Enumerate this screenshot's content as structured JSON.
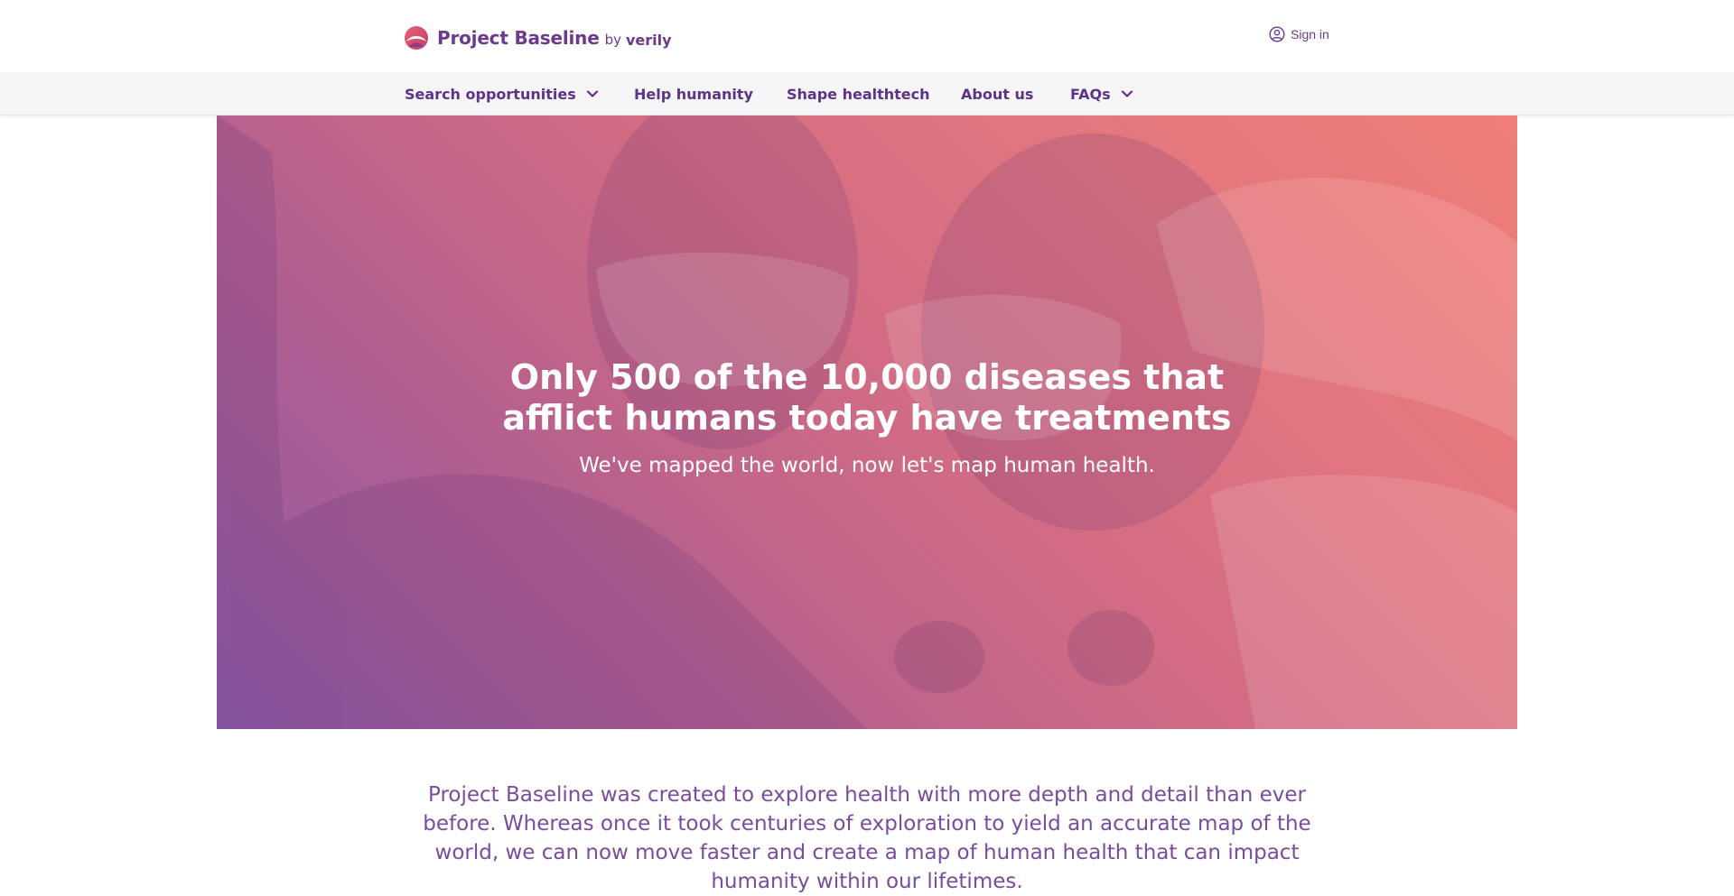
{
  "brand": {
    "name": "Project Baseline",
    "by": "by",
    "partner": "verily",
    "icon": "baseline-logo-icon",
    "primary_color": "#6b3a8d"
  },
  "header": {
    "signin_label": "Sign in",
    "signin_icon": "user-circle-icon"
  },
  "nav": {
    "items": [
      {
        "label": "Search opportunities",
        "has_dropdown": true
      },
      {
        "label": "Help humanity",
        "has_dropdown": false
      },
      {
        "label": "Shape healthtech",
        "has_dropdown": false
      },
      {
        "label": "About us",
        "has_dropdown": false
      },
      {
        "label": "FAQs",
        "has_dropdown": true
      }
    ],
    "background": "#f6f5f7",
    "text_color": "#5c3386"
  },
  "hero": {
    "title": "Only 500 of the 10,000 diseases that afflict humans today have treatments",
    "subtitle": "We've mapped the world, now let's map human health.",
    "gradient_colors": [
      "#8d5aa6",
      "#d06b84",
      "#f07e76"
    ]
  },
  "intro": {
    "text": "Project Baseline was created to explore health with more depth and detail than ever before. Whereas once it took centuries of exploration to yield an accurate map of the world, we can now move faster and create a map of human health that can impact humanity within our lifetimes.",
    "color": "#7a4c9c"
  }
}
